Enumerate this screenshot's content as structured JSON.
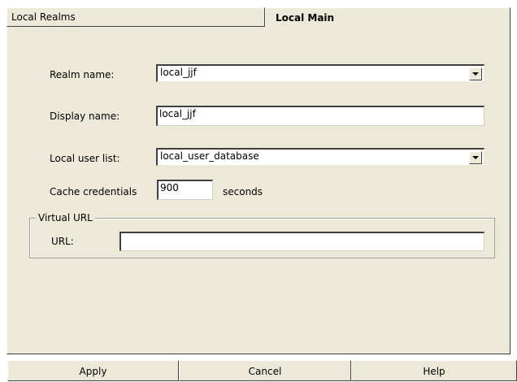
{
  "tabs": {
    "local_realms": "Local Realms",
    "local_main": "Local Main"
  },
  "form": {
    "realm_name": {
      "label": "Realm name:",
      "value": "local_jjf"
    },
    "display_name": {
      "label": "Display name:",
      "value": "local_jjf"
    },
    "local_user_list": {
      "label": "Local user list:",
      "value": "local_user_database"
    },
    "cache_credentials": {
      "label": "Cache credentials",
      "value": "900",
      "unit": "seconds"
    },
    "virtual_url": {
      "legend": "Virtual URL",
      "url_label": "URL:",
      "url_value": ""
    }
  },
  "buttons": {
    "apply": "Apply",
    "cancel": "Cancel",
    "help": "Help"
  },
  "icons": {
    "dropdown": "chevron-down-icon"
  }
}
